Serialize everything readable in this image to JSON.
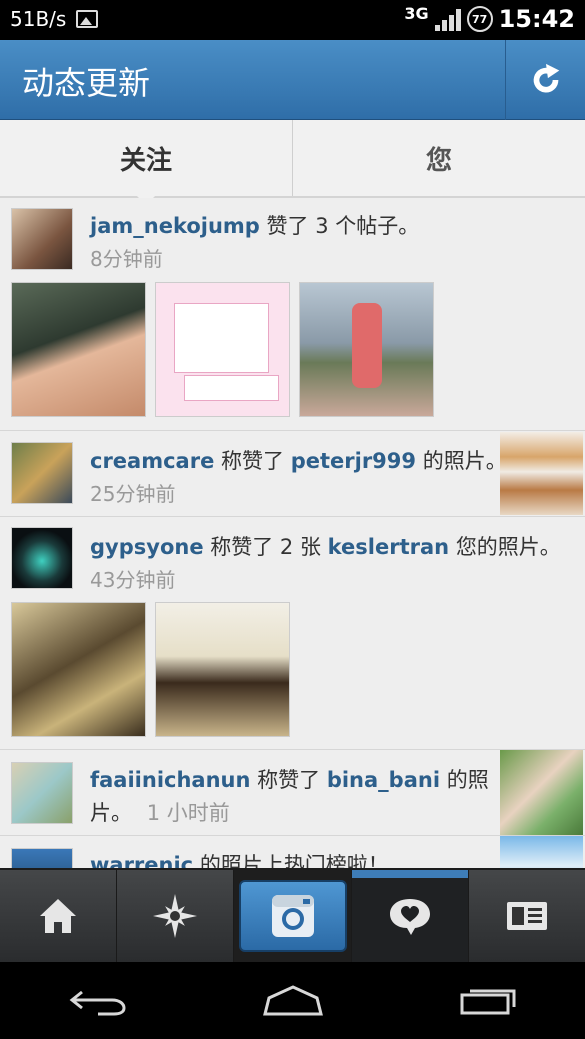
{
  "status_bar": {
    "speed": "51B/s",
    "network": "3G",
    "battery": "77",
    "time": "15:42"
  },
  "header": {
    "title": "动态更新",
    "refresh_icon": "refresh-icon"
  },
  "tabs": [
    {
      "label": "关注",
      "active": true
    },
    {
      "label": "您",
      "active": false
    }
  ],
  "feed": [
    {
      "user": "jam_nekojump",
      "action": "赞了 3 个帖子。",
      "time": "8分钟前"
    },
    {
      "user": "creamcare",
      "action_pre": "称赞了",
      "target": "peterjr999",
      "action_post": "的照片。",
      "time": "25分钟前"
    },
    {
      "user": "gypsyone",
      "action_pre": "称赞了 2 张",
      "target": "keslertran",
      "action_post": "您的照片。",
      "time": "43分钟前"
    },
    {
      "user": "faaiinichanun",
      "action_pre": "称赞了",
      "target": "bina_bani",
      "action_post": "的照",
      "line2": "片。",
      "time": "1 小时前"
    },
    {
      "user": "warrenic",
      "action": "的照片上热门榜啦！"
    }
  ],
  "bottom_nav": [
    "home-icon",
    "explore-icon",
    "camera-icon",
    "news-icon",
    "profile-icon"
  ],
  "system_nav": [
    "back-icon",
    "home-outline-icon",
    "recent-apps-icon"
  ],
  "colors": {
    "header_blue": "#2f6ea8",
    "username": "#2d5f8b",
    "nav_dark": "#2a2c2e"
  }
}
